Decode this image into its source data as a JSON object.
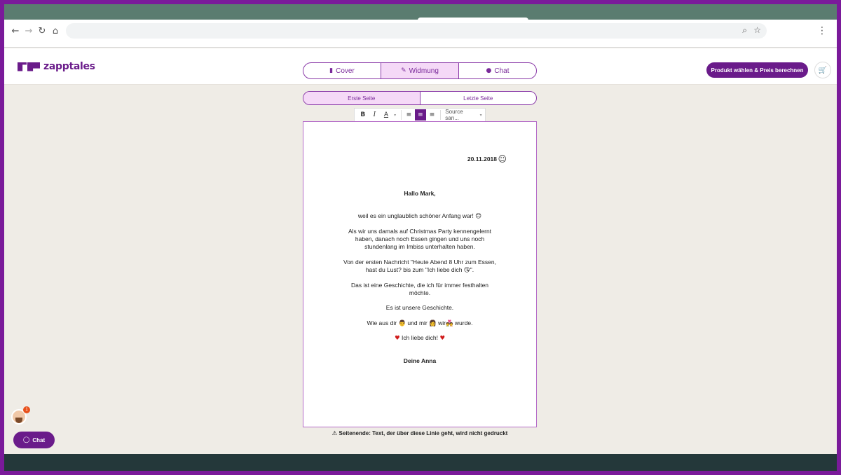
{
  "browser": {
    "url": ""
  },
  "app": {
    "logo_text": "zapptales"
  },
  "mode_tabs": [
    {
      "label": "Cover",
      "icon": "book-icon",
      "glyph": "▮",
      "active": false
    },
    {
      "label": "Widmung",
      "icon": "edit-icon",
      "glyph": "✎",
      "active": true
    },
    {
      "label": "Chat",
      "icon": "chat-icon",
      "glyph": "●",
      "active": false
    }
  ],
  "header": {
    "cta_label": "Produkt wählen & Preis berechnen"
  },
  "page_tabs": [
    {
      "label": "Erste Seite",
      "active": true
    },
    {
      "label": "Letzte Seite",
      "active": false
    }
  ],
  "toolbar": {
    "font_label": "Source san..."
  },
  "letter": {
    "date": "20.11.2018",
    "greeting": "Hallo Mark,",
    "line1": "weil es ein unglaublich schöner Anfang war!",
    "para2": [
      "Als wir uns damals auf Christmas Party kennengelernt",
      "haben, danach noch Essen gingen und uns noch",
      "stundenlang im Imbiss unterhalten haben."
    ],
    "para3a": "Von der ersten Nachricht \"Heute Abend 8 Uhr zum Essen,",
    "para3b": "hast du Lust? bis zum \"Ich liebe dich",
    "para3b_end": "\".",
    "para4": [
      "Das ist eine Geschichte, die ich für immer festhalten",
      "möchte."
    ],
    "para5": "Es ist unsere Geschichte.",
    "para6_a": "Wie aus dir",
    "para6_b": "und mir",
    "para6_c": "wir",
    "para6_d": "wurde.",
    "para7": "Ich liebe dich!",
    "sign": "Deine Anna"
  },
  "footnote": "Seitenende: Text, der über diese Linie geht, wird nicht gedruckt",
  "chat_widget": {
    "badge": "1",
    "label": "Chat"
  },
  "colors": {
    "brand": "#6a1b8a",
    "active_tab": "#f5d9f7",
    "background": "#efece6"
  }
}
